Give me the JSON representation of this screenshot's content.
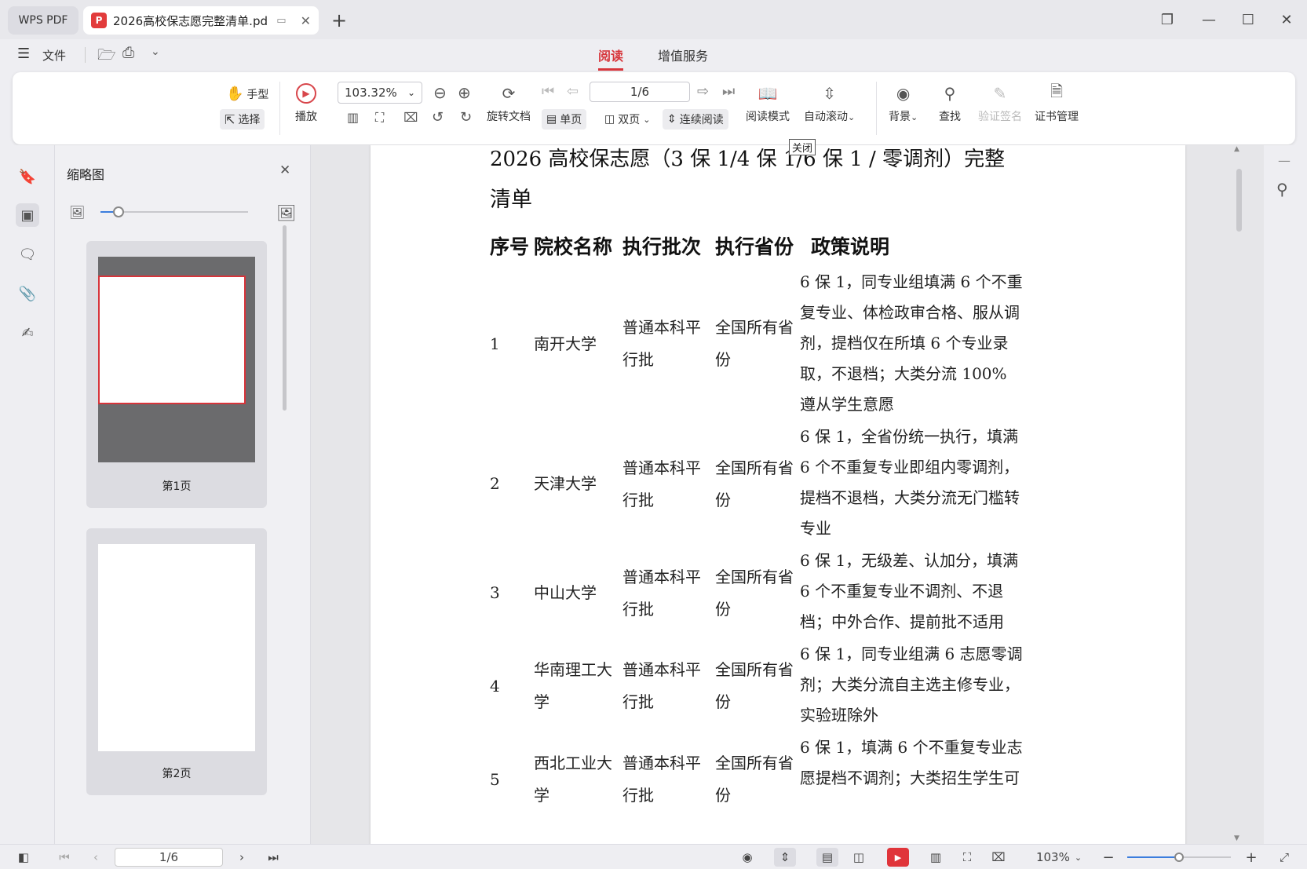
{
  "titlebar": {
    "app_tab": "WPS PDF",
    "doc_tab": "2026高校保志愿完整清单.pd",
    "pdf_logo": "P"
  },
  "menubar": {
    "menu_label": "文件",
    "tabs": [
      {
        "label": "阅读"
      },
      {
        "label": "增值服务"
      }
    ]
  },
  "ribbon": {
    "hand": "手型",
    "select": "选择",
    "play": "播放",
    "zoom": "103.32%",
    "rotate_doc": "旋转文档",
    "single": "单页",
    "double": "双页",
    "continuous": "连续阅读",
    "page_input": "1/6",
    "read_mode": "阅读模式",
    "auto_scroll": "自动滚动",
    "background": "背景",
    "find": "查找",
    "verify_sign": "验证签名",
    "cert_manage": "证书管理",
    "tooltip": "关闭"
  },
  "thumbs": {
    "title": "缩略图",
    "pages": [
      {
        "label": "第1页"
      },
      {
        "label": "第2页"
      }
    ],
    "slider_value": 0.12
  },
  "document": {
    "title_line1": "2026 高校保志愿（3 保 1/4 保 1/6 保 1 / 零调剂）完整",
    "title_line2": "清单",
    "headers": [
      "序号",
      "院校名称",
      "执行批次",
      "执行省份",
      "政策说明"
    ],
    "rows": [
      {
        "no": "1",
        "school": "南开大学",
        "batch": "普通本科平行批",
        "province": "全国所有省份",
        "policy": "6 保 1，同专业组填满 6 个不重复专业、体检政审合格、服从调剂，提档仅在所填 6 个专业录取，不退档；大类分流 100% 遵从学生意愿"
      },
      {
        "no": "2",
        "school": "天津大学",
        "batch": "普通本科平行批",
        "province": "全国所有省份",
        "policy": "6 保 1，全省份统一执行，填满 6 个不重复专业即组内零调剂，提档不退档，大类分流无门槛转专业"
      },
      {
        "no": "3",
        "school": "中山大学",
        "batch": "普通本科平行批",
        "province": "全国所有省份",
        "policy": "6 保 1，无级差、认加分，填满 6 个不重复专业不调剂、不退档；中外合作、提前批不适用"
      },
      {
        "no": "4",
        "school": "华南理工大学",
        "batch": "普通本科平行批",
        "province": "全国所有省份",
        "policy": "6 保 1，同专业组满 6 志愿零调剂；大类分流自主选主修专业，实验班除外"
      },
      {
        "no": "5",
        "school": "西北工业大学",
        "batch": "普通本科平行批",
        "province": "全国所有省份",
        "policy": "6 保 1，填满 6 个不重复专业志愿提档不调剂；大类招生学生可"
      }
    ]
  },
  "statusbar": {
    "page": "1/6",
    "zoom": "103%",
    "zoom_fraction": 0.5
  }
}
